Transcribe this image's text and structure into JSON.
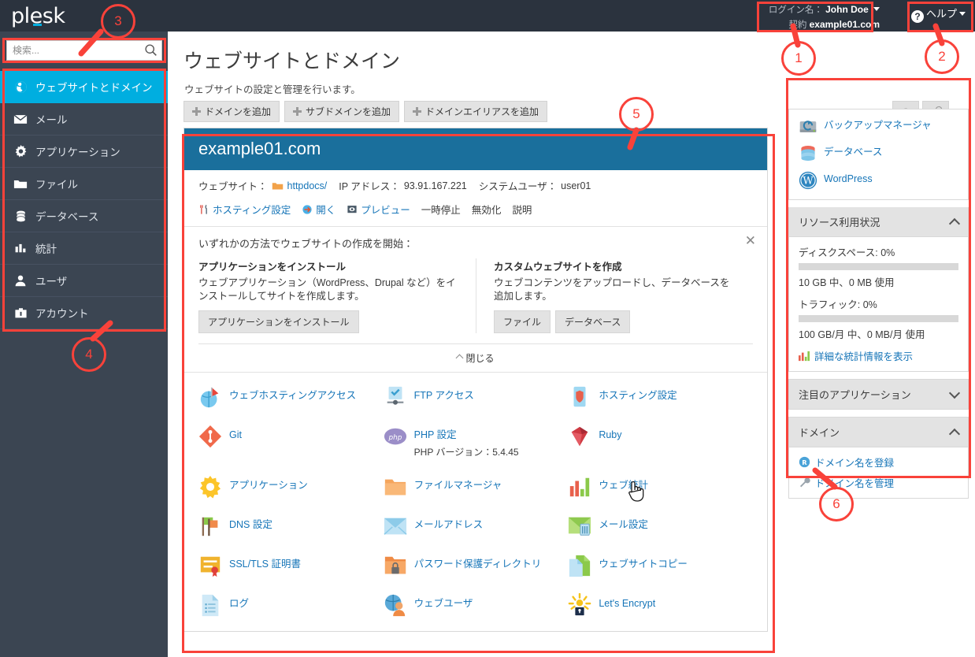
{
  "brand": {
    "logo": "plesk"
  },
  "header": {
    "login_label": "ログイン名：",
    "login_user": "John Doe",
    "subscription_label": "契約",
    "subscription_value": "example01.com",
    "help_label": "ヘルプ"
  },
  "search": {
    "placeholder": "検索...",
    "value": ""
  },
  "sidebar": {
    "items": [
      {
        "label": "ウェブサイトとドメイン",
        "icon": "globe-icon",
        "active": true
      },
      {
        "label": "メール",
        "icon": "envelope-icon",
        "active": false
      },
      {
        "label": "アプリケーション",
        "icon": "gear-icon",
        "active": false
      },
      {
        "label": "ファイル",
        "icon": "folder-icon",
        "active": false
      },
      {
        "label": "データベース",
        "icon": "database-icon",
        "active": false
      },
      {
        "label": "統計",
        "icon": "bar-chart-icon",
        "active": false
      },
      {
        "label": "ユーザ",
        "icon": "user-icon",
        "active": false
      },
      {
        "label": "アカウント",
        "icon": "account-icon",
        "active": false
      }
    ]
  },
  "main": {
    "title": "ウェブサイトとドメイン",
    "subtitle": "ウェブサイトの設定と管理を行います。",
    "toolbar": [
      {
        "label": "ドメインを追加"
      },
      {
        "label": "サブドメインを追加"
      },
      {
        "label": "ドメインエイリアスを追加"
      }
    ],
    "util_buttons": [
      {
        "name": "help-button",
        "glyph": "?"
      },
      {
        "name": "wrench-button",
        "glyph": "wrench"
      }
    ]
  },
  "domain": {
    "name": "example01.com",
    "website_label": "ウェブサイト：",
    "website_path": "httpdocs/",
    "ip_label": "IP アドレス：",
    "ip_value": "93.91.167.221",
    "sysuser_label": "システムユーザ：",
    "sysuser_value": "user01",
    "actions": [
      {
        "label": "ホスティング設定",
        "type": "link",
        "icon": "tools-icon"
      },
      {
        "label": "開く",
        "type": "link",
        "icon": "open-arrow-icon"
      },
      {
        "label": "プレビュー",
        "type": "link",
        "icon": "preview-icon"
      },
      {
        "label": "一時停止",
        "type": "plain",
        "icon": ""
      },
      {
        "label": "無効化",
        "type": "plain",
        "icon": ""
      },
      {
        "label": "説明",
        "type": "plain",
        "icon": ""
      }
    ]
  },
  "promo": {
    "title": "いずれかの方法でウェブサイトの作成を開始：",
    "close_glyph": "✕",
    "left": {
      "heading": "アプリケーションをインストール",
      "text": "ウェブアプリケーション（WordPress、Drupal など）をインストールしてサイトを作成します。",
      "buttons": [
        {
          "label": "アプリケーションをインストール"
        }
      ]
    },
    "right": {
      "heading": "カスタムウェブサイトを作成",
      "text": "ウェブコンテンツをアップロードし、データベースを追加します。",
      "buttons": [
        {
          "label": "ファイル"
        },
        {
          "label": "データベース"
        }
      ]
    },
    "collapse_label": "閉じる"
  },
  "tools_grid": [
    {
      "label": "ウェブホスティングアクセス",
      "icon": "hosting-access-icon",
      "sub": ""
    },
    {
      "label": "FTP アクセス",
      "icon": "ftp-access-icon",
      "sub": ""
    },
    {
      "label": "ホスティング設定",
      "icon": "hosting-settings-icon",
      "sub": ""
    },
    {
      "label": "Git",
      "icon": "git-icon",
      "sub": ""
    },
    {
      "label": "PHP 設定",
      "icon": "php-icon",
      "sub": "PHP バージョン：5.4.45"
    },
    {
      "label": "Ruby",
      "icon": "ruby-icon",
      "sub": ""
    },
    {
      "label": "アプリケーション",
      "icon": "applications-icon",
      "sub": ""
    },
    {
      "label": "ファイルマネージャ",
      "icon": "file-manager-icon",
      "sub": ""
    },
    {
      "label": "ウェブ統計",
      "icon": "web-statistics-icon",
      "sub": ""
    },
    {
      "label": "DNS 設定",
      "icon": "dns-icon",
      "sub": ""
    },
    {
      "label": "メールアドレス",
      "icon": "mail-address-icon",
      "sub": ""
    },
    {
      "label": "メール設定",
      "icon": "mail-settings-icon",
      "sub": ""
    },
    {
      "label": "SSL/TLS 証明書",
      "icon": "ssl-certificate-icon",
      "sub": ""
    },
    {
      "label": "パスワード保護ディレクトリ",
      "icon": "protected-directory-icon",
      "sub": ""
    },
    {
      "label": "ウェブサイトコピー",
      "icon": "website-copy-icon",
      "sub": ""
    },
    {
      "label": "ログ",
      "icon": "logs-icon",
      "sub": ""
    },
    {
      "label": "ウェブユーザ",
      "icon": "web-users-icon",
      "sub": ""
    },
    {
      "label": "Let's Encrypt",
      "icon": "lets-encrypt-icon",
      "sub": ""
    }
  ],
  "right_panel": {
    "quick_links": [
      {
        "label": "バックアップマネージャ",
        "icon": "backup-manager-icon"
      },
      {
        "label": "データベース",
        "icon": "database-icon"
      },
      {
        "label": "WordPress",
        "icon": "wordpress-icon"
      }
    ],
    "resource": {
      "heading": "リソース利用状況",
      "expanded": true,
      "disk_label": "ディスクスペース: 0%",
      "disk_percent": 0,
      "disk_note": "10 GB 中、0 MB 使用",
      "traffic_label": "トラフィック: 0%",
      "traffic_percent": 0,
      "traffic_note": "100 GB/月 中、0 MB/月 使用",
      "stats_link": "詳細な統計情報を表示"
    },
    "featured": {
      "heading": "注目のアプリケーション",
      "expanded": false
    },
    "domains": {
      "heading": "ドメイン",
      "expanded": true,
      "links": [
        {
          "label": "ドメイン名を登録",
          "icon": "register-domain-icon"
        },
        {
          "label": "ドメイン名を管理",
          "icon": "manage-domain-icon"
        }
      ]
    }
  },
  "annotations": {
    "callouts": [
      {
        "number": "1"
      },
      {
        "number": "2"
      },
      {
        "number": "3"
      },
      {
        "number": "4"
      },
      {
        "number": "5"
      },
      {
        "number": "6"
      }
    ]
  }
}
